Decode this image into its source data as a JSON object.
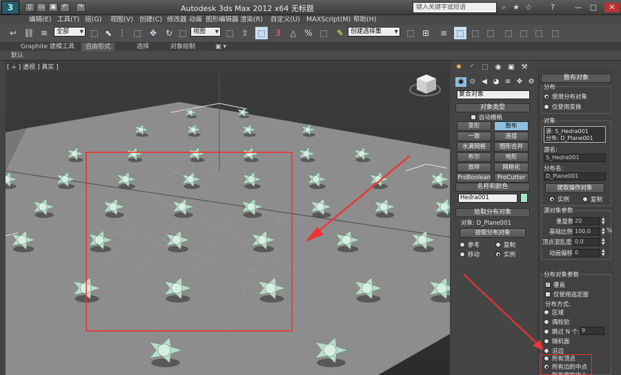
{
  "titlebar": {
    "logo": "3",
    "title": "Autodesk 3ds Max  2012 x64      无标题",
    "search_placeholder": "键入关键字或短语",
    "quick_access": [
      "▯",
      "▭",
      "▣",
      "↶",
      "↷"
    ],
    "right_icons": [
      "⌕",
      "★",
      "☆",
      "?",
      "—",
      "▢",
      "✕"
    ]
  },
  "menubar": {
    "items": [
      "编辑(E)",
      "工具(T)",
      "组(G)",
      "视图(V)",
      "创建(C)",
      "修改器",
      "动画",
      "图形编辑器",
      "渲染(R)",
      "自定义(U)",
      "MAXScript(M)",
      "帮助(H)"
    ]
  },
  "toolbar": {
    "selection_filter": "全部",
    "ref_coord": "视图",
    "named_selection": "创建选择集",
    "snap_label": "3",
    "icons": [
      "↩",
      "⛓",
      "≋",
      "⬚",
      "⬉",
      "⋮",
      "⬚",
      "⬚",
      "✥",
      "↻",
      "⬚",
      "⬚",
      "⇧",
      "⬚",
      "⬚",
      "△",
      "%",
      "⬚",
      "✎",
      "⬚",
      "⊞",
      "≡",
      "⬚",
      "⬚",
      "⬚",
      "⬚",
      "⬚",
      "⬚"
    ]
  },
  "ribbon": {
    "tabs": [
      "Graphite 建模工具",
      "自由形式",
      "选择",
      "对象绘制",
      "▣ ▾"
    ],
    "sub_label": "默认"
  },
  "viewport": {
    "label": "[ + ] 透视 ] 真实 ]"
  },
  "cmdpanel": {
    "tab_icons": [
      "✹",
      "◜",
      "⬚",
      "◉",
      "▣",
      "⚒"
    ],
    "sub_icons": [
      "◉",
      "⊙",
      "◀",
      "◕",
      "≋",
      "✥",
      "⚙"
    ],
    "category": "复合对象",
    "object_type": {
      "title": "对象类型",
      "autogrid": "自动栅格",
      "buttons": [
        [
          "变形",
          "散布"
        ],
        [
          "一致",
          "连接"
        ],
        [
          "水滴网格",
          "图形合并"
        ],
        [
          "布尔",
          "地形"
        ],
        [
          "放样",
          "网格化"
        ],
        [
          "ProBoolean",
          "ProCutter"
        ]
      ],
      "active": "散布"
    },
    "name_color": {
      "title": "名称和颜色",
      "name": "Hedra001",
      "swatch": "#a8e4c8"
    },
    "pick_dist": {
      "title": "拾取分布对象",
      "object_label": "对象: D_Plane001",
      "pick_button": "拾取分布对象",
      "ref": "参考",
      "copy": "复制",
      "move": "移动",
      "instance": "实例"
    },
    "scatter": {
      "title": "散布对象",
      "dist_label": "分布",
      "use_dist": "使用分布对象",
      "use_transforms": "仅使用变换",
      "objects_label": "对象",
      "list": [
        "源: S_Hedra001",
        "分布: D_Plane001"
      ],
      "source_name_label": "源名:",
      "source_name": "S_Hedra001",
      "dist_name_label": "分布名:",
      "dist_name": "D_Plane001",
      "extract_button": "提取操作对象",
      "instance": "实例",
      "copy": "复制",
      "source_params": "源对象参数",
      "dup_label": "重复数:",
      "dup_value": "20",
      "base_scale_label": "基础比例:",
      "base_scale_value": "100.0",
      "pct": "%",
      "vertex_chaos_label": "顶点混乱度:",
      "vertex_chaos_value": "0.0",
      "anim_offset_label": "动画偏移:",
      "anim_offset_value": "0",
      "dist_params": "分布对象参数",
      "perpendicular": "垂直",
      "selected_faces": "仅使用选定面",
      "method_label": "分布方式:",
      "methods": [
        "区域",
        "偶校验",
        "跳过 N 个:",
        "随机面",
        "沿边",
        "所有顶点",
        "所有边的中点",
        "所有面的中心"
      ],
      "skip_value": "9",
      "selected_method": "所有边的中点"
    }
  }
}
